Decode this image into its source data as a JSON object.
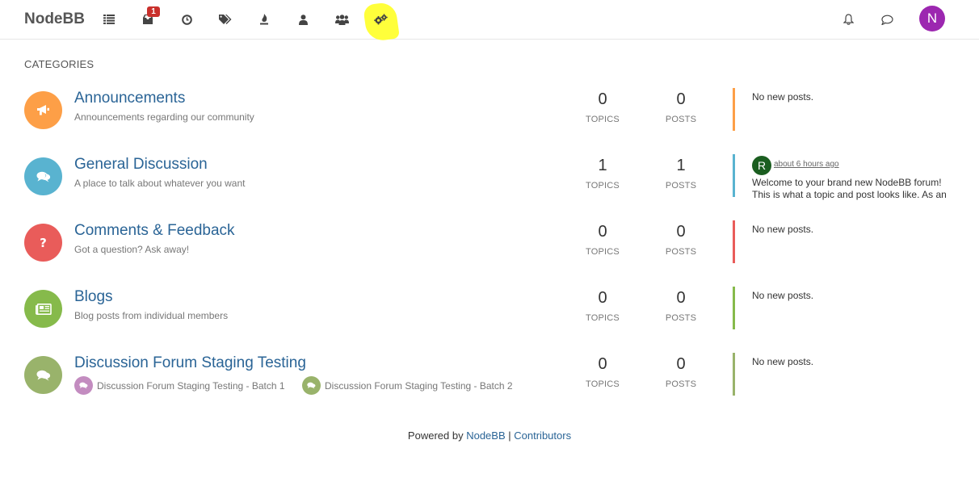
{
  "navbar": {
    "brand": "NodeBB",
    "icons": [
      {
        "name": "categories-list-icon"
      },
      {
        "name": "unread-inbox-icon"
      },
      {
        "name": "recent-clock-icon"
      },
      {
        "name": "tags-icon"
      },
      {
        "name": "popular-fire-icon"
      },
      {
        "name": "users-icon"
      },
      {
        "name": "groups-icon"
      },
      {
        "name": "admin-cogs-icon"
      }
    ],
    "unread_badge": "1",
    "user_avatar_letter": "N"
  },
  "page": {
    "section_title": "CATEGORIES"
  },
  "categories": [
    {
      "title": "Announcements",
      "description": "Announcements regarding our community",
      "icon": "bullhorn-icon",
      "color": "#fd9f47",
      "topics": "0",
      "topics_label": "TOPICS",
      "posts": "0",
      "posts_label": "POSTS",
      "last_post": "No new posts."
    },
    {
      "title": "General Discussion",
      "description": "A place to talk about whatever you want",
      "icon": "comments-icon",
      "color": "#59b3d0",
      "topics": "1",
      "topics_label": "TOPICS",
      "posts": "1",
      "posts_label": "POSTS",
      "teaser": {
        "avatar_letter": "R",
        "time": "about 6 hours ago",
        "text": "Welcome to your brand new NodeBB forum! This is what a topic and post looks like. As an"
      }
    },
    {
      "title": "Comments & Feedback",
      "description": "Got a question? Ask away!",
      "icon": "question-icon",
      "color": "#e95c5a",
      "topics": "0",
      "topics_label": "TOPICS",
      "posts": "0",
      "posts_label": "POSTS",
      "last_post": "No new posts."
    },
    {
      "title": "Blogs",
      "description": "Blog posts from individual members",
      "icon": "newspaper-icon",
      "color": "#86ba4b",
      "topics": "0",
      "topics_label": "TOPICS",
      "posts": "0",
      "posts_label": "POSTS",
      "last_post": "No new posts."
    },
    {
      "title": "Discussion Forum Staging Testing",
      "icon": "comments-icon",
      "color": "#99b36b",
      "subcategories": [
        {
          "label": "Discussion Forum Staging Testing - Batch 1",
          "color": "#c38cc0"
        },
        {
          "label": "Discussion Forum Staging Testing - Batch 2",
          "color": "#99b36b"
        }
      ],
      "topics": "0",
      "topics_label": "TOPICS",
      "posts": "0",
      "posts_label": "POSTS",
      "last_post": "No new posts."
    }
  ],
  "footer": {
    "powered_by": "Powered by",
    "nodebb_link": "NodeBB",
    "separator": "|",
    "contributors_link": "Contributors"
  }
}
